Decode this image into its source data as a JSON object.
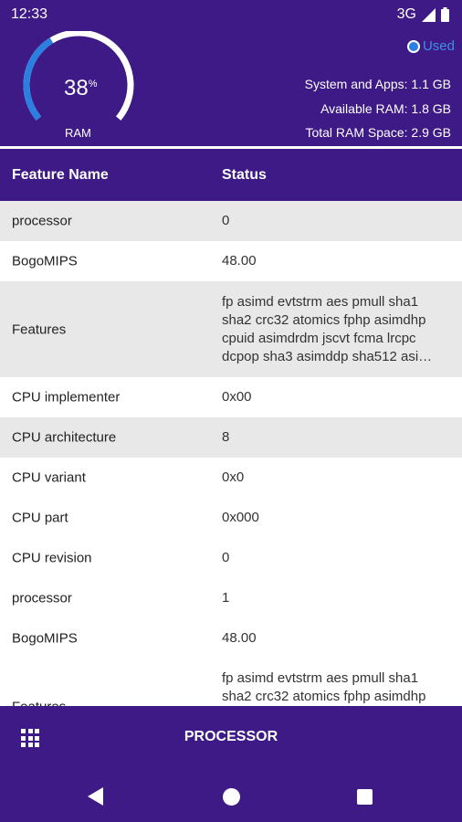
{
  "status_bar": {
    "time": "12:33",
    "network": "3G"
  },
  "ram": {
    "percent": "38",
    "percent_unit": "%",
    "label": "RAM",
    "used_fraction": 0.38,
    "legend_label": "Used",
    "stats": [
      {
        "label": "System and Apps:",
        "value": "1.1 GB"
      },
      {
        "label": "Available RAM:",
        "value": "1.8 GB"
      },
      {
        "label": "Total RAM Space:",
        "value": "2.9 GB"
      }
    ]
  },
  "table": {
    "headers": [
      "Feature Name",
      "Status"
    ],
    "rows": [
      {
        "name": "processor",
        "value": "0"
      },
      {
        "name": "BogoMIPS",
        "value": "48.00"
      },
      {
        "name": "Features",
        "value": "fp asimd evtstrm aes pmull sha1 sha2 crc32 atomics fphp asimdhp cpuid asimdrdm jscvt fcma lrcpc dcpop sha3 asimddp sha512 asi…"
      },
      {
        "name": "CPU implementer",
        "value": "0x00"
      },
      {
        "name": "CPU architecture",
        "value": "8"
      },
      {
        "name": "CPU variant",
        "value": "0x0"
      },
      {
        "name": "CPU part",
        "value": "0x000"
      },
      {
        "name": "CPU revision",
        "value": "0"
      },
      {
        "name": "processor",
        "value": "1"
      },
      {
        "name": "BogoMIPS",
        "value": "48.00"
      },
      {
        "name": "Features",
        "value": "fp asimd evtstrm aes pmull sha1 sha2 crc32 atomics fphp asimdhp cpuid asimdrdm jscvt fcma lrcpc"
      }
    ]
  },
  "bottom_bar": {
    "title": "PROCESSOR",
    "menu_icon": "grid-menu-icon"
  },
  "nav_bar": {
    "back_icon": "back-icon",
    "home_icon": "home-icon",
    "recents_icon": "recents-icon"
  },
  "colors": {
    "primary": "#3d1a86",
    "accent": "#2b7fe0",
    "row_alt": "#e8e8e8"
  }
}
